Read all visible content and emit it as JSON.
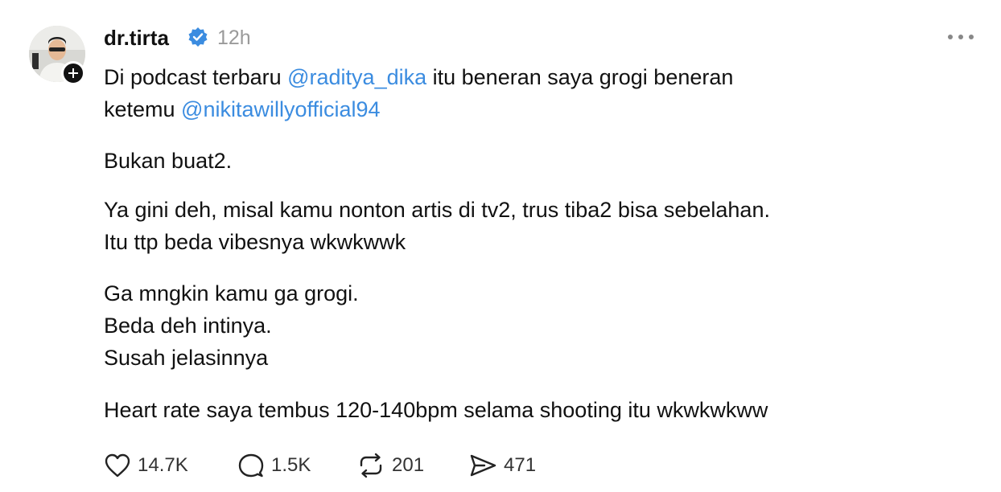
{
  "post": {
    "author": {
      "username": "dr.tirta",
      "verified": true,
      "avatar": "profile-photo",
      "follow_badge": "plus-icon"
    },
    "timestamp": "12h",
    "more_menu_icon": "more-horizontal-icon",
    "body": {
      "p1_text_1": "Di podcast terbaru ",
      "p1_mention_1": "@raditya_dika",
      "p1_text_2": " itu beneran saya grogi beneran",
      "p1_text_3": "ketemu ",
      "p1_mention_2": "@nikitawillyofficial94",
      "p2": "Bukan buat2.",
      "p3_line1": "Ya gini deh, misal kamu nonton artis di tv2, trus tiba2 bisa sebelahan.",
      "p3_line2": "Itu ttp beda vibesnya wkwkwwk",
      "p4_line1": "Ga mngkin kamu ga grogi.",
      "p4_line2": "Beda deh intinya.",
      "p4_line3": "Susah jelasinnya",
      "p5": "Heart rate saya tembus 120-140bpm selama shooting itu wkwkwkww"
    },
    "actions": {
      "like": {
        "icon": "heart-icon",
        "count": "14.7K"
      },
      "reply": {
        "icon": "comment-icon",
        "count": "1.5K"
      },
      "repost": {
        "icon": "repost-icon",
        "count": "201"
      },
      "share": {
        "icon": "send-icon",
        "count": "471"
      }
    },
    "colors": {
      "mention": "#3b8ce0",
      "verified_badge": "#3b8ce0",
      "muted_text": "#9a9a9a"
    }
  }
}
